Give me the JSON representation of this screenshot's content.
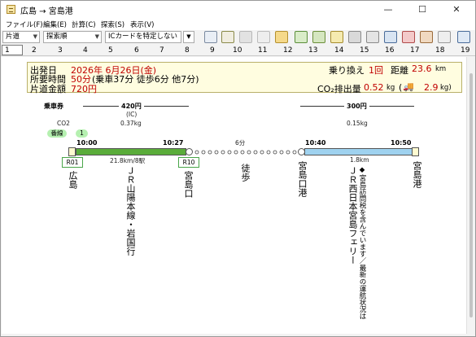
{
  "window": {
    "title": "広島 → 宮島港",
    "minimize": "—",
    "maximize": "☐",
    "close": "✕"
  },
  "menu": [
    {
      "label": "ファイル(F)"
    },
    {
      "label": "編集(E)"
    },
    {
      "label": "計算(C)"
    },
    {
      "label": "探索(S)"
    },
    {
      "label": "表示(V)"
    }
  ],
  "toolbar": {
    "fare_type": "片道",
    "sort_order": "探索順",
    "ic_card": "ICカードを特定しない"
  },
  "tabs": [
    "1",
    "2",
    "3",
    "4",
    "5",
    "6",
    "7",
    "8",
    "9",
    "10",
    "11",
    "12",
    "13",
    "14",
    "15",
    "16",
    "17",
    "18",
    "19"
  ],
  "summary": {
    "departure_label": "出発日",
    "departure_value": "2026年 6月26日(金)",
    "duration_label": "所要時間",
    "duration_value": "50分",
    "duration_detail": "(乗車37分 徒歩6分 他7分)",
    "fare_label": "片道金額",
    "fare_value": "720円",
    "transfer_label": "乗り換え",
    "transfer_value": "1回",
    "distance_label": "距離",
    "distance_value": "23.6",
    "distance_unit": "km",
    "co2_label": "CO₂排出量",
    "co2_value": "0.52",
    "co2_unit": "kg",
    "co2_car_value": "2.9",
    "co2_car_unit": "kg)",
    "co2_car_open": "(",
    "truck_icon": "🚚"
  },
  "route": {
    "ticket_label": "乗車券",
    "co2_label": "CO2",
    "fare1": "420円",
    "fare1_note": "(IC)",
    "co2_1": "0.37kg",
    "fare2": "300円",
    "co2_2": "0.15kg",
    "platform_label": "番線",
    "platform_value": "1",
    "seg1_depart": "10:00",
    "seg1_arrive": "10:27",
    "seg1_detail": "21.8km/8駅",
    "walk_time": "6分",
    "walk_label": "徒歩",
    "seg2_depart": "10:40",
    "seg2_arrive": "10:50",
    "seg2_distance": "1.8km",
    "station1": "広島",
    "station1_code": "R01",
    "line1": "ＪＲ山陽本線・岩国行",
    "station2": "宮島口",
    "station2_code": "R10",
    "station3": "宮島口港",
    "line2": "ＪＲ西日本宮島フェリー",
    "line2_note": "◆宮島訪問税を含んでいます／最新の運航状況は",
    "station4": "宮島港"
  },
  "colors": {
    "jr_line": "#5aac3a",
    "ferry": "#9fd2ef",
    "summary_bg": "#fffde0",
    "accent_red": "#c00000"
  }
}
